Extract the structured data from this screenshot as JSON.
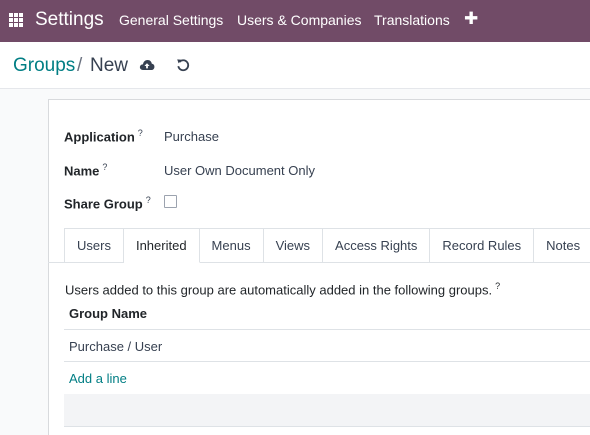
{
  "navbar": {
    "app_title": "Settings",
    "menu": [
      "General Settings",
      "Users & Companies",
      "Translations"
    ],
    "plus_symbol": "✚"
  },
  "breadcrumb": {
    "parent": "Groups",
    "separator": "/",
    "current": "New"
  },
  "form": {
    "application_label": "Application",
    "application_value": "Purchase",
    "name_label": "Name",
    "name_value": "User Own Document Only",
    "share_group_label": "Share Group",
    "share_group_checked": false,
    "help_marker": "?"
  },
  "tabs": [
    {
      "label": "Users",
      "active": false
    },
    {
      "label": "Inherited",
      "active": true
    },
    {
      "label": "Menus",
      "active": false
    },
    {
      "label": "Views",
      "active": false
    },
    {
      "label": "Access Rights",
      "active": false
    },
    {
      "label": "Record Rules",
      "active": false
    },
    {
      "label": "Notes",
      "active": false
    }
  ],
  "inherited": {
    "info_text": "Users added to this group are automatically added in the following groups.",
    "column_header": "Group Name",
    "rows": [
      "Purchase / User"
    ],
    "add_line": "Add a line"
  },
  "colors": {
    "navbar": "#714b67",
    "link": "#017e84"
  }
}
